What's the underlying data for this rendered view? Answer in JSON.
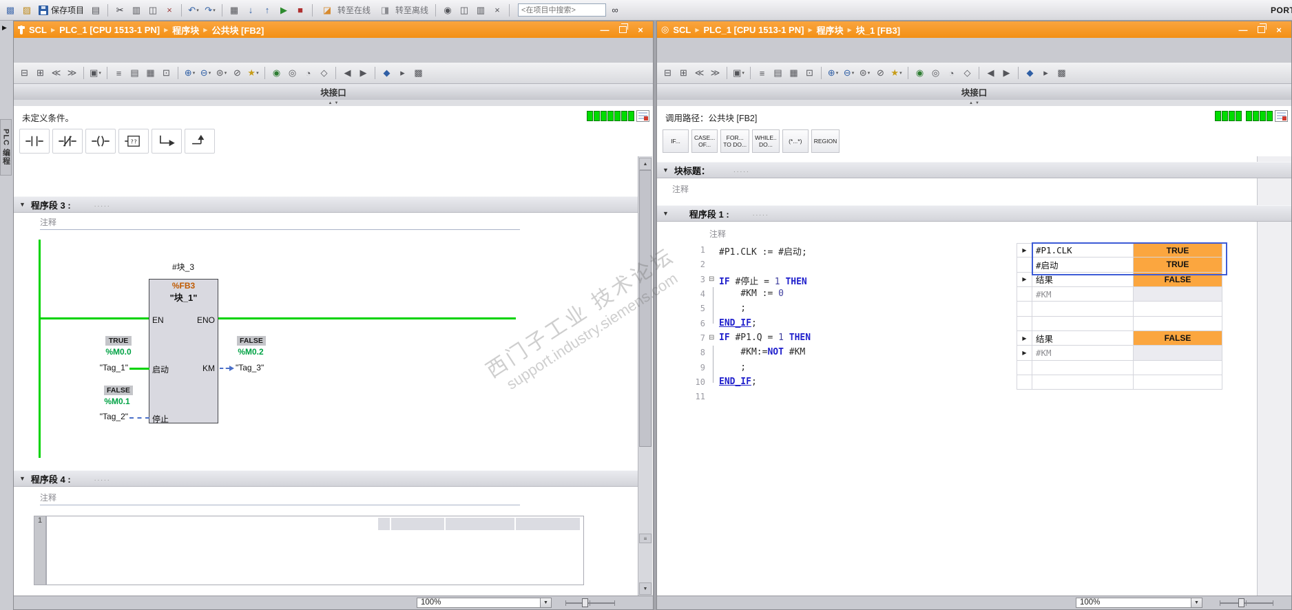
{
  "colors": {
    "titlebar_orange": "#F39014",
    "power_green": "#00D300",
    "monitor_orange": "#FBA63F",
    "address_green": "#00A244",
    "keyword_blue": "#2020CC"
  },
  "icons": {
    "collapse": "▼",
    "up": "▲",
    "down": "▼",
    "right": "▶",
    "fold": "⊟",
    "dropdown": "▾",
    "handle_up": "▲",
    "handle_down": "▼",
    "splitter": "≡"
  },
  "top_toolbar": {
    "save_label": "保存项目",
    "go_online_label": "转至在线",
    "go_offline_label": "转至离线",
    "search_placeholder": "<在项目中搜索>",
    "portal_label": "PORTAL",
    "icons1": [
      [
        "new-project-icon",
        "▩",
        "#4C72B0"
      ],
      [
        "open-project-icon",
        "▨",
        "#BE8A1C"
      ]
    ],
    "icons2": [
      [
        "print-icon",
        "▤",
        "#54555A"
      ],
      "|",
      [
        "cut-icon",
        "✂",
        "#33343A"
      ],
      [
        "copy-icon",
        "▥",
        "#54555A"
      ],
      [
        "paste-icon",
        "◫",
        "#54555A"
      ],
      [
        "delete-icon",
        "×",
        "#9E3A3A"
      ],
      "|",
      [
        "undo-icon",
        "↶",
        "#2F5FA5",
        "dd"
      ],
      [
        "redo-icon",
        "↷",
        "#2F5FA5",
        "dd"
      ],
      "|"
    ],
    "icons3": [
      [
        "compile-icon",
        "▦",
        "#54555A"
      ],
      [
        "download-to-device-icon",
        "↓",
        "#2F5FA5"
      ],
      [
        "upload-from-device-icon",
        "↑",
        "#2F5FA5"
      ],
      [
        "start-cpu-icon",
        "▶",
        "#2E8B2E"
      ],
      [
        "stop-cpu-icon",
        "■",
        "#B03030"
      ],
      "|"
    ],
    "icons4": [
      "|",
      [
        "accessible-devices-icon",
        "◉",
        "#54555A"
      ],
      [
        "split-editor-icon",
        "◫",
        "#54555A"
      ],
      [
        "window-columns-icon",
        "▥",
        "#54555A"
      ],
      [
        "close-editor-icon",
        "×",
        "#54555A"
      ],
      "|"
    ],
    "icons5": [
      [
        "find-in-project-icon",
        "∞",
        "#33343A"
      ]
    ],
    "online_icon": [
      "go-online-icon",
      "◪",
      "#D78A2E"
    ],
    "offline_icon": [
      "go-offline-icon",
      "◨",
      "#8A8B90"
    ]
  },
  "side_tab": {
    "label": "PLC 编程"
  },
  "watermark": {
    "line1": "西门子工业 技术论坛",
    "line2": "support.industry.siemens.com"
  },
  "left_editor": {
    "breadcrumb": [
      "SCL",
      "PLC_1 [CPU 1513-1 PN]",
      "程序块",
      "公共块 [FB2]"
    ],
    "toolbar_icons": [
      [
        "collapse-networks-icon",
        "⊟",
        "#54555A"
      ],
      [
        "expand-networks-icon",
        "⊞",
        "#54555A"
      ],
      [
        "outdent-icon",
        "≪",
        "#54555A"
      ],
      [
        "indent-icon",
        "≫",
        "#54555A"
      ],
      "|",
      [
        "absolute-operands-icon",
        "▣",
        "#54555A",
        "dd"
      ],
      "|",
      [
        "network-overview-icon",
        "≡",
        "#54555A"
      ],
      [
        "insert-network-icon",
        "▤",
        "#54555A"
      ],
      [
        "insert-empty-box-icon",
        "▦",
        "#54555A"
      ],
      [
        "comment-icon",
        "⊡",
        "#54555A"
      ],
      "|",
      [
        "add-input-icon",
        "⊕",
        "#2F5FA5",
        "dd"
      ],
      [
        "remove-input-icon",
        "⊖",
        "#2F5FA5",
        "dd"
      ],
      [
        "compare-icon",
        "⊜",
        "#54555A",
        "dd"
      ],
      [
        "negate-icon",
        "⊘",
        "#54555A"
      ],
      [
        "favorites-icon",
        "★",
        "#C79C18",
        "dd"
      ],
      "|",
      [
        "monitor-on-icon",
        "◉",
        "#2E7D32"
      ],
      [
        "monitor-off-icon",
        "◎",
        "#54555A"
      ],
      [
        "snapshot-icon",
        "◔",
        "#54555A"
      ],
      [
        "retain-values-icon",
        "◇",
        "#54555A"
      ],
      "|",
      [
        "previous-icon",
        "◀",
        "#54555A"
      ],
      [
        "next-icon",
        "▶",
        "#54555A"
      ],
      "|",
      [
        "settings-icon",
        "◆",
        "#2F5FA5"
      ],
      [
        "more-icon",
        "▸",
        "#54555A"
      ],
      [
        "layout-icon",
        "▩",
        "#54555A"
      ]
    ],
    "interface_label": "块接口",
    "status_text": "未定义条件。",
    "status_blocks": [
      7
    ],
    "favorites": [
      "contact-no-icon",
      "contact-nc-icon",
      "coil-icon",
      "empty-box-icon",
      "open-branch-icon",
      "close-branch-icon"
    ],
    "network3": {
      "title": "程序段 3 :",
      "title_dots": ".....",
      "comment": "注释",
      "ladder": {
        "instance_name": "#块_3",
        "block_type": "%FB3",
        "block_name": "\"块_1\"",
        "en_label": "EN",
        "eno_label": "ENO",
        "input1": {
          "pin": "启动",
          "value": "TRUE",
          "address": "%M0.0",
          "tag": "\"Tag_1\""
        },
        "input2": {
          "pin": "停止",
          "value": "FALSE",
          "address": "%M0.1",
          "tag": "\"Tag_2\""
        },
        "output1": {
          "pin": "KM",
          "value": "FALSE",
          "address": "%M0.2",
          "tag": "\"Tag_3\""
        }
      }
    },
    "network4": {
      "title": "程序段 4 :",
      "title_dots": ".....",
      "comment": "注释",
      "gutter_line": "1"
    },
    "zoom_value": "100%"
  },
  "right_editor": {
    "breadcrumb": [
      "SCL",
      "PLC_1 [CPU 1513-1 PN]",
      "程序块",
      "块_1 [FB3]"
    ],
    "toolbar_icons": [
      [
        "collapse-regions-icon",
        "⊟",
        "#54555A"
      ],
      [
        "expand-regions-icon",
        "⊞",
        "#54555A"
      ],
      [
        "outdent-icon",
        "≪",
        "#54555A"
      ],
      [
        "indent-icon",
        "≫",
        "#54555A"
      ],
      "|",
      [
        "absolute-operands-icon",
        "▣",
        "#54555A",
        "dd"
      ],
      "|",
      [
        "network-overview-icon",
        "≡",
        "#54555A"
      ],
      [
        "insert-network-icon",
        "▤",
        "#54555A"
      ],
      [
        "insert-empty-box-icon",
        "▦",
        "#54555A"
      ],
      [
        "comment-icon",
        "⊡",
        "#54555A"
      ],
      "|",
      [
        "add-input-icon",
        "⊕",
        "#2F5FA5",
        "dd"
      ],
      [
        "remove-input-icon",
        "⊖",
        "#2F5FA5",
        "dd"
      ],
      [
        "compare-icon",
        "⊜",
        "#54555A",
        "dd"
      ],
      [
        "negate-icon",
        "⊘",
        "#54555A"
      ],
      [
        "favorites-icon",
        "★",
        "#C79C18",
        "dd"
      ],
      "|",
      [
        "monitor-on-icon",
        "◉",
        "#2E7D32"
      ],
      [
        "monitor-off-icon",
        "◎",
        "#54555A"
      ],
      [
        "snapshot-icon",
        "◔",
        "#54555A"
      ],
      [
        "retain-values-icon",
        "◇",
        "#54555A"
      ],
      "|",
      [
        "previous-icon",
        "◀",
        "#54555A"
      ],
      [
        "next-icon",
        "▶",
        "#54555A"
      ],
      "|",
      [
        "settings-icon",
        "◆",
        "#2F5FA5"
      ],
      [
        "more-icon",
        "▸",
        "#54555A"
      ],
      [
        "layout-icon",
        "▩",
        "#54555A"
      ]
    ],
    "interface_label": "块接口",
    "call_path": "调用路径：公共块 [FB2]",
    "status_blocks": [
      4,
      4
    ],
    "snippets": [
      "IF...",
      "CASE...\nOF...",
      "FOR...\nTO DO...",
      "WHILE..\nDO...",
      "(*...*)",
      "REGION"
    ],
    "snippet_names": [
      "snippet-if-button",
      "snippet-case-button",
      "snippet-for-button",
      "snippet-while-button",
      "snippet-comment-button",
      "snippet-region-button"
    ],
    "block_title": {
      "title": "块标题：",
      "title_dots": ".....",
      "comment": "注释"
    },
    "network1": {
      "title": "程序段 1 :",
      "title_dots": ".....",
      "comment": "注释"
    },
    "code_lines": [
      {
        "n": "1",
        "tokens": [
          [
            "v",
            "#P1.CLK"
          ],
          [
            "p",
            " := "
          ],
          [
            "v",
            "#启动"
          ],
          [
            "p",
            ";"
          ]
        ],
        "monitor": {
          "arrow": true,
          "name": "#P1.CLK",
          "value": "TRUE",
          "orange": true
        }
      },
      {
        "n": "2",
        "tokens": [],
        "monitor": {
          "name": "#启动",
          "value": "TRUE",
          "orange": true
        }
      },
      {
        "n": "3",
        "fold": true,
        "tokens": [
          [
            "k",
            "IF"
          ],
          [
            "p",
            " "
          ],
          [
            "v",
            "#停止"
          ],
          [
            "p",
            " = "
          ],
          [
            "c",
            "1"
          ],
          [
            "p",
            " "
          ],
          [
            "k",
            "THEN"
          ]
        ],
        "monitor": {
          "arrow": true,
          "name": "结果",
          "value": "FALSE",
          "orange": true
        }
      },
      {
        "n": "4",
        "tokens": [
          [
            "p",
            "    "
          ],
          [
            "v",
            "#KM"
          ],
          [
            "p",
            " := "
          ],
          [
            "c",
            "0"
          ]
        ],
        "monitor": {
          "name": "#KM",
          "gray": true
        }
      },
      {
        "n": "5",
        "tokens": [
          [
            "p",
            "    ;"
          ]
        ],
        "monitor": {}
      },
      {
        "n": "6",
        "tokens": [
          [
            "ku",
            "END_IF"
          ],
          [
            "p",
            ";"
          ]
        ],
        "monitor": {}
      },
      {
        "n": "7",
        "fold": true,
        "tokens": [
          [
            "k",
            "IF"
          ],
          [
            "p",
            " "
          ],
          [
            "v",
            "#P1.Q"
          ],
          [
            "p",
            " = "
          ],
          [
            "c",
            "1"
          ],
          [
            "p",
            " "
          ],
          [
            "k",
            "THEN"
          ]
        ],
        "monitor": {
          "arrow": true,
          "name": "结果",
          "value": "FALSE",
          "orange": true
        }
      },
      {
        "n": "8",
        "tokens": [
          [
            "p",
            "    "
          ],
          [
            "v",
            "#KM"
          ],
          [
            "p",
            ":="
          ],
          [
            "k",
            "NOT"
          ],
          [
            "p",
            " "
          ],
          [
            "v",
            "#KM"
          ]
        ],
        "monitor": {
          "arrow": true,
          "name": "#KM",
          "gray": true
        }
      },
      {
        "n": "9",
        "tokens": [
          [
            "p",
            "    ;"
          ]
        ],
        "monitor": {}
      },
      {
        "n": "10",
        "tokens": [
          [
            "ku",
            "END_IF"
          ],
          [
            "p",
            ";"
          ]
        ],
        "monitor": {}
      },
      {
        "n": "11",
        "tokens": []
      }
    ],
    "zoom_value": "100%"
  }
}
